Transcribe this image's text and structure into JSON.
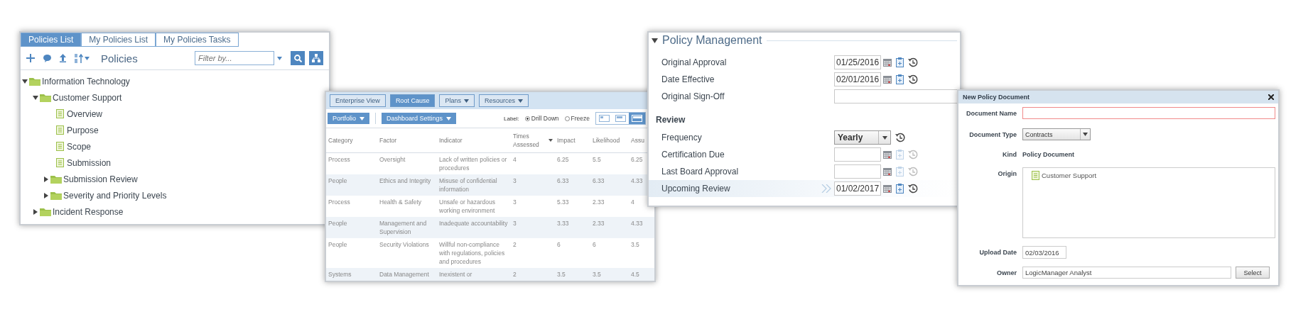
{
  "policies_panel": {
    "tabs": [
      {
        "label": "Policies List",
        "selected": true
      },
      {
        "label": "My Policies List",
        "selected": false
      },
      {
        "label": "My Policies Tasks",
        "selected": false
      }
    ],
    "title": "Policies",
    "filter": {
      "placeholder": "Filter by..."
    },
    "tree": [
      {
        "label": "Information Technology",
        "kind": "folder",
        "expanded": true,
        "children": [
          {
            "label": "Customer Support",
            "kind": "folder",
            "expanded": true,
            "children": [
              {
                "label": "Overview",
                "kind": "document"
              },
              {
                "label": "Purpose",
                "kind": "document"
              },
              {
                "label": "Scope",
                "kind": "document"
              },
              {
                "label": "Submission",
                "kind": "document"
              },
              {
                "label": "Submission Review",
                "kind": "folder",
                "expanded": false
              },
              {
                "label": "Severity and Priority Levels",
                "kind": "folder",
                "expanded": false
              }
            ]
          },
          {
            "label": "Incident Response",
            "kind": "folder",
            "expanded": false
          }
        ]
      }
    ]
  },
  "dashboard_panel": {
    "view_buttons": [
      {
        "label": "Enterprise View",
        "selected": false,
        "dropdown": false
      },
      {
        "label": "Root Cause",
        "selected": true,
        "dropdown": false
      },
      {
        "label": "Plans",
        "selected": false,
        "dropdown": true
      },
      {
        "label": "Resources",
        "selected": false,
        "dropdown": true
      }
    ],
    "action_buttons": [
      "Portfolio",
      "Dashboard Settings"
    ],
    "label_option": {
      "label": "Label:",
      "options": [
        {
          "label": "Drill Down",
          "selected": true
        },
        {
          "label": "Freeze",
          "selected": false
        }
      ]
    },
    "view_toggles": [
      {
        "selected": false
      },
      {
        "selected": false
      },
      {
        "selected": true
      }
    ],
    "table": {
      "columns": [
        {
          "label": "Category",
          "sorted": false
        },
        {
          "label": "Factor",
          "sorted": false
        },
        {
          "label": "Indicator",
          "sorted": false
        },
        {
          "label": "Times Assessed",
          "sorted": true
        },
        {
          "label": "Impact",
          "sorted": false
        },
        {
          "label": "Likelihood",
          "sorted": false
        },
        {
          "label": "Assu",
          "sorted": false
        }
      ],
      "rows": [
        [
          "Process",
          "Oversight",
          "Lack of written policies or procedures",
          "4",
          "6.25",
          "5.5",
          "6.25"
        ],
        [
          "People",
          "Ethics and Integrity",
          "Misuse of confidential information",
          "3",
          "6.33",
          "6.33",
          "4.33"
        ],
        [
          "Process",
          "Health & Safety",
          "Unsafe or hazardous working environment",
          "3",
          "5.33",
          "2.33",
          "4"
        ],
        [
          "People",
          "Management and Supervision",
          "Inadequate accountability",
          "3",
          "3.33",
          "2.33",
          "4.33"
        ],
        [
          "People",
          "Security Violations",
          "Willful non-compliance with regulations, policies and procedures",
          "2",
          "6",
          "6",
          "3.5"
        ],
        [
          "Systems",
          "Data Management",
          "Inexistent or",
          "2",
          "3.5",
          "3.5",
          "4.5"
        ]
      ]
    }
  },
  "policy_management": {
    "title": "Policy Management",
    "expanded": true,
    "fields": [
      {
        "label": "Original Approval",
        "kind": "date",
        "value": "01/25/2016",
        "disabled": false,
        "highlighted": false
      },
      {
        "label": "Date Effective",
        "kind": "date",
        "value": "02/01/2016",
        "disabled": false,
        "highlighted": false
      },
      {
        "label": "Original Sign-Off",
        "kind": "text",
        "highlighted": false
      }
    ],
    "review": {
      "heading": "Review",
      "fields": [
        {
          "label": "Frequency",
          "kind": "select",
          "value": "Yearly",
          "highlighted": false
        },
        {
          "label": "Certification Due",
          "kind": "date",
          "disabled": true,
          "highlighted": false
        },
        {
          "label": "Last Board Approval",
          "kind": "date",
          "disabled": true,
          "highlighted": false
        },
        {
          "label": "Upcoming Review",
          "kind": "date",
          "value": "01/02/2017",
          "disabled": false,
          "highlighted": true
        }
      ]
    }
  },
  "new_document_dialog": {
    "title": "New Policy Document",
    "fields": [
      {
        "label": "Document Name",
        "kind": "text",
        "invalid": true
      },
      {
        "label": "Document Type",
        "kind": "select",
        "value": "Contracts"
      },
      {
        "label": "Kind",
        "kind": "static",
        "value": "Policy Document"
      },
      {
        "label": "Origin",
        "kind": "tree",
        "items": [
          {
            "label": "Customer Support"
          }
        ]
      },
      {
        "label": "Upload Date",
        "kind": "date",
        "value": "02/03/2016"
      },
      {
        "label": "Owner",
        "kind": "picker",
        "value": "LogicManager Analyst",
        "button": "Select"
      }
    ]
  }
}
